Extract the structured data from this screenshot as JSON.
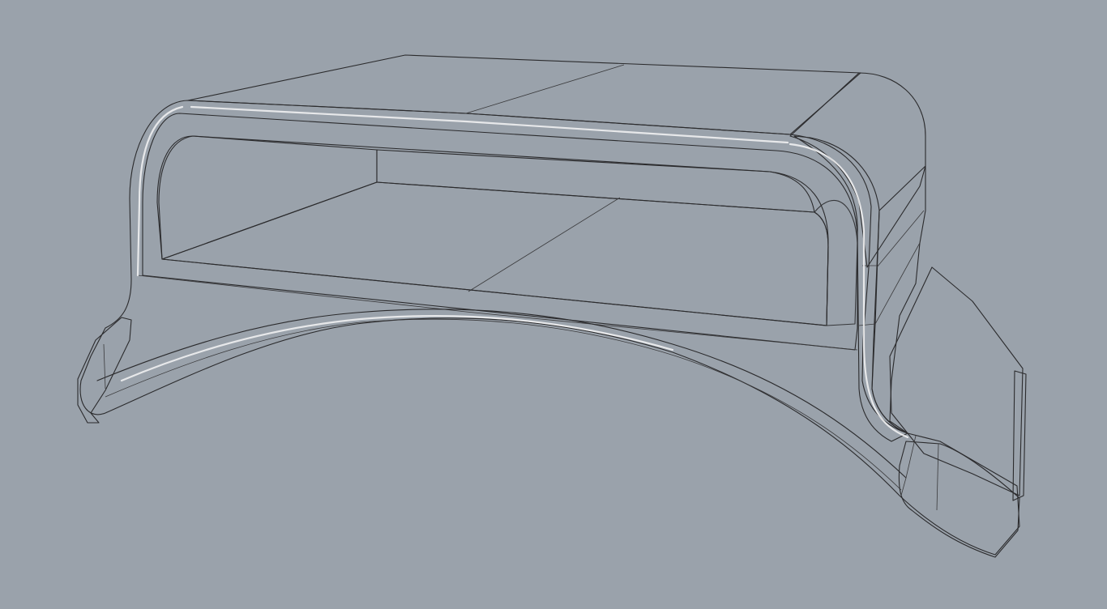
{
  "viewport": {
    "background_color": "#9aa2ab",
    "render_mode": "shaded",
    "object": "swept-arch-bracket-model"
  },
  "colors": {
    "dark_face": "#5e6064",
    "light_face": "#b9b9b7",
    "mid_face": "#a9a9a7",
    "edge": "#2b2b2d"
  }
}
